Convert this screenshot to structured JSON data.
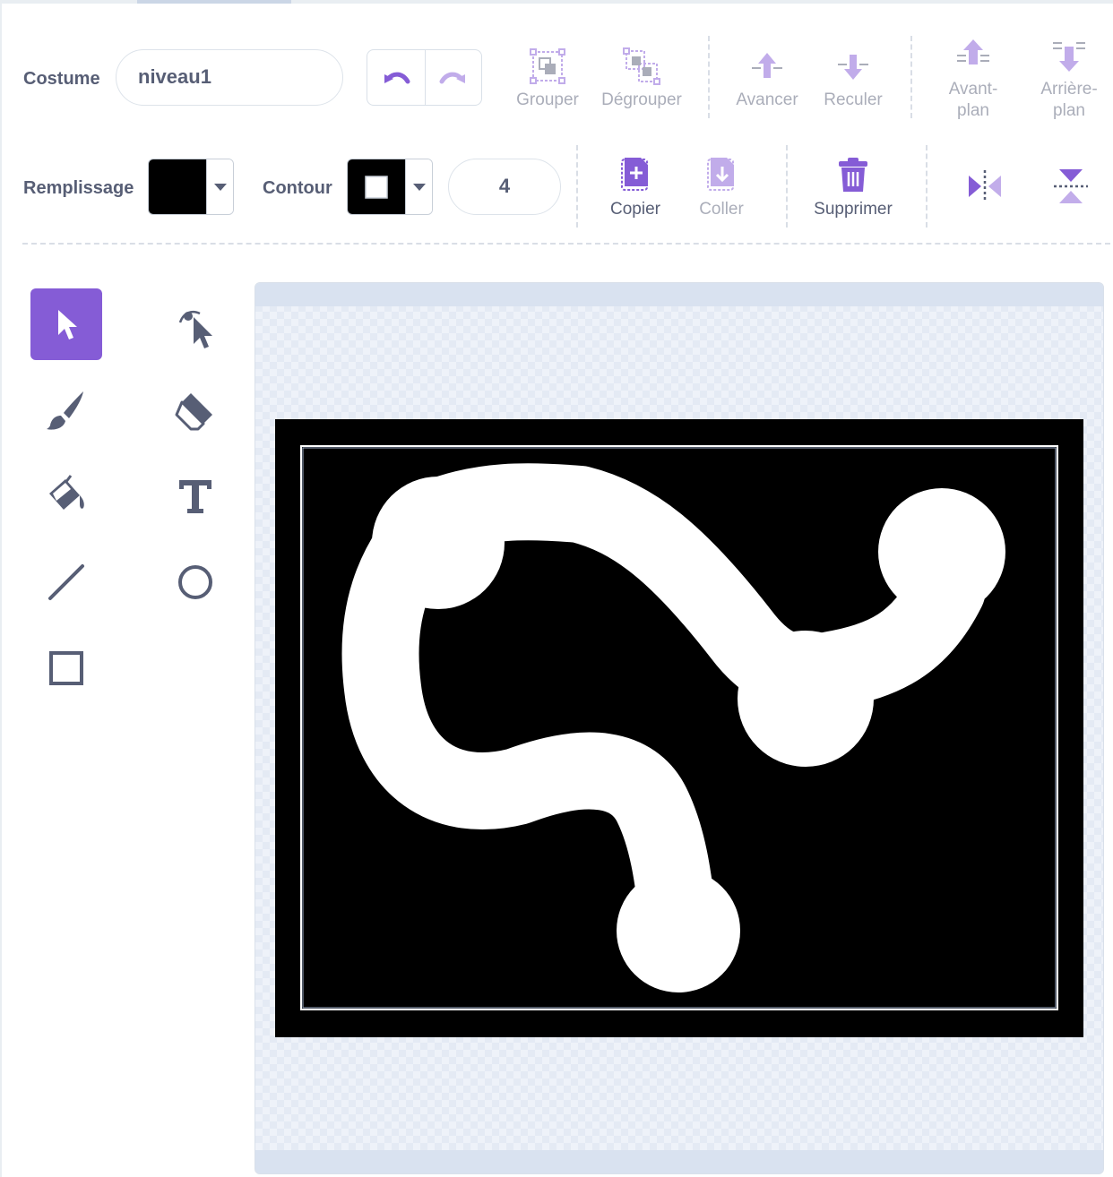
{
  "costume": {
    "label": "Costume",
    "name": "niveau1"
  },
  "history": {
    "undo_icon": "undo-icon",
    "redo_icon": "redo-icon"
  },
  "arrange": {
    "group": "Grouper",
    "ungroup": "Dégrouper",
    "forward": "Avancer",
    "backward": "Reculer",
    "front_line1": "Avant-",
    "front_line2": "plan",
    "back_line1": "Arrière-",
    "back_line2": "plan"
  },
  "style": {
    "fill_label": "Remplissage",
    "fill_color": "#000000",
    "outline_label": "Contour",
    "outline_color": "#000000",
    "outline_width": "4"
  },
  "edit": {
    "copy": "Copier",
    "paste": "Coller",
    "delete": "Supprimer"
  },
  "tools": [
    "select",
    "reshape",
    "brush",
    "eraser",
    "fill",
    "text",
    "line",
    "circle",
    "rectangle"
  ],
  "colors": {
    "accent": "#855cd6",
    "text": "#575e75",
    "icon_gray": "#575e75"
  }
}
